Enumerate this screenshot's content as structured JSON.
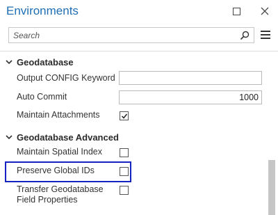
{
  "window": {
    "title": "Environments",
    "maximize_icon": "maximize-icon",
    "close_icon": "close-icon"
  },
  "search": {
    "placeholder": "Search",
    "icon": "search-icon"
  },
  "menu_icon": "hamburger-menu-icon",
  "groups": [
    {
      "title": "Geodatabase",
      "expanded": true,
      "rows": [
        {
          "label": "Output CONFIG Keyword",
          "type": "text",
          "value": ""
        },
        {
          "label": "Auto Commit",
          "type": "text",
          "value": "1000"
        },
        {
          "label": "Maintain Attachments",
          "type": "checkbox",
          "checked": true
        }
      ]
    },
    {
      "title": "Geodatabase Advanced",
      "expanded": true,
      "rows": [
        {
          "label": "Maintain Spatial Index",
          "type": "checkbox",
          "checked": false
        },
        {
          "label": "Preserve Global IDs",
          "type": "checkbox",
          "checked": false,
          "highlighted": true
        },
        {
          "label": "Transfer Geodatabase Field Properties",
          "type": "checkbox",
          "checked": false
        }
      ]
    }
  ],
  "colors": {
    "title": "#1f6eb5",
    "highlight_border": "#1423c2"
  }
}
